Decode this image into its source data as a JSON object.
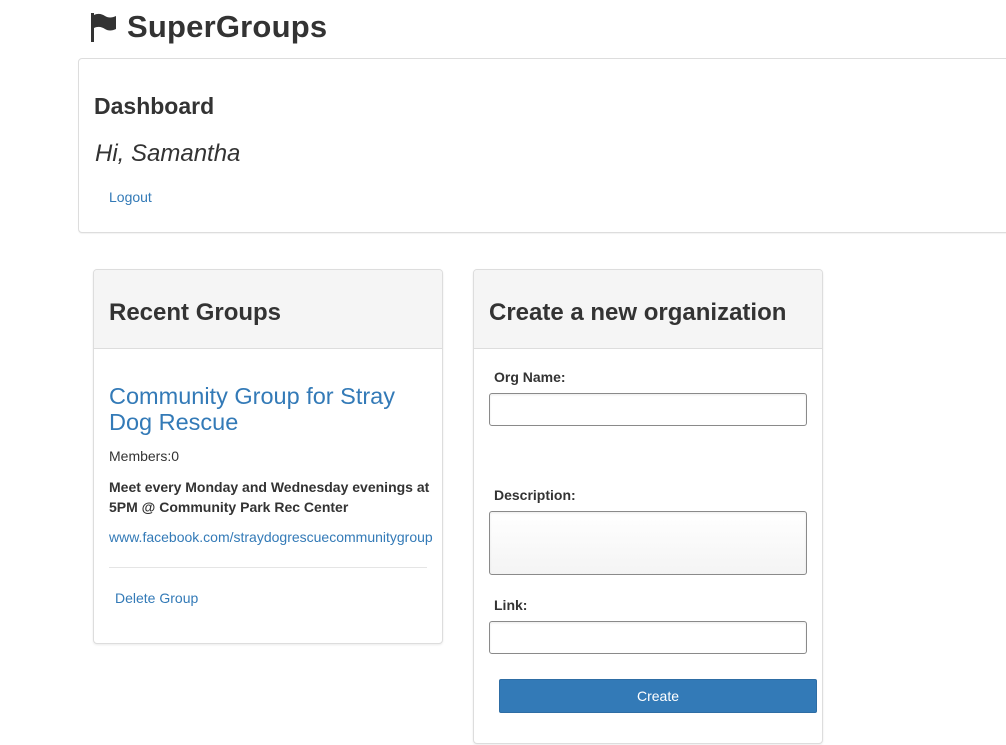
{
  "brand": {
    "icon": "flag-icon",
    "title": "SuperGroups"
  },
  "dashboard": {
    "title": "Dashboard",
    "greeting": "Hi, Samantha",
    "logout_label": "Logout"
  },
  "recent_groups": {
    "heading": "Recent Groups",
    "groups": [
      {
        "name": "Community Group for Stray Dog Rescue",
        "members": "Members:0",
        "description": "Meet every Monday and Wednesday evenings at 5PM @ Community Park Rec Center",
        "link": "www.facebook.com/straydogrescuecommunitygroup",
        "delete_label": "Delete Group"
      }
    ]
  },
  "create_org": {
    "heading": "Create a new organization",
    "name_label": "Org Name:",
    "name_value": "",
    "description_label": "Description:",
    "description_value": "",
    "link_label": "Link:",
    "link_value": "",
    "submit_label": "Create"
  },
  "colors": {
    "link": "#337ab7",
    "primary_button": "#337ab7",
    "panel_heading_bg": "#f5f5f5",
    "border": "#dddddd"
  }
}
